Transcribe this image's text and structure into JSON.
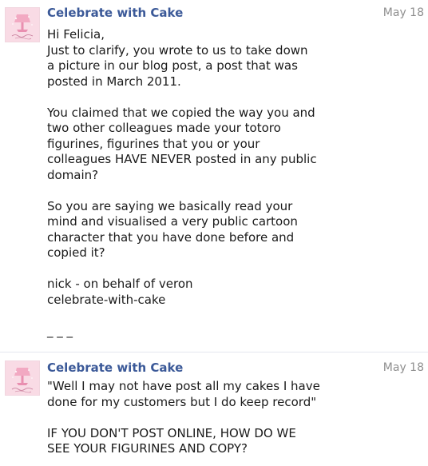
{
  "messages": [
    {
      "sender": "Celebrate with Cake",
      "date": "May 18",
      "avatar_icon": "cake-stand-logo-icon",
      "paragraphs": [
        "Hi Felicia,\nJust to clarify, you wrote to us to take down\na picture in our blog post, a post that was\nposted in March 2011.",
        "You claimed that we copied the way you and\ntwo other colleagues made your totoro\nfigurines, figurines that you or your\ncolleagues HAVE NEVER posted in any public\ndomain?",
        "So you are saying we basically read your\nmind and visualised a very public cartoon\ncharacter that you have done before and\ncopied it?",
        "nick - on behalf of veron\ncelebrate-with-cake",
        "_ _ _"
      ]
    },
    {
      "sender": "Celebrate with Cake",
      "date": "May 18",
      "avatar_icon": "cake-stand-logo-icon",
      "paragraphs": [
        "\"Well I may not have post all my cakes I have\ndone for my customers but I do keep record\"",
        "IF YOU DON'T POST ONLINE, HOW DO WE\nSEE YOUR FIGURINES AND COPY?"
      ]
    }
  ],
  "colors": {
    "sender_link": "#3b5998",
    "date": "#8f8f8f",
    "body_text": "#1a1a1a",
    "divider": "#e4e6ee",
    "avatar_pink": "#f6cfdc"
  }
}
